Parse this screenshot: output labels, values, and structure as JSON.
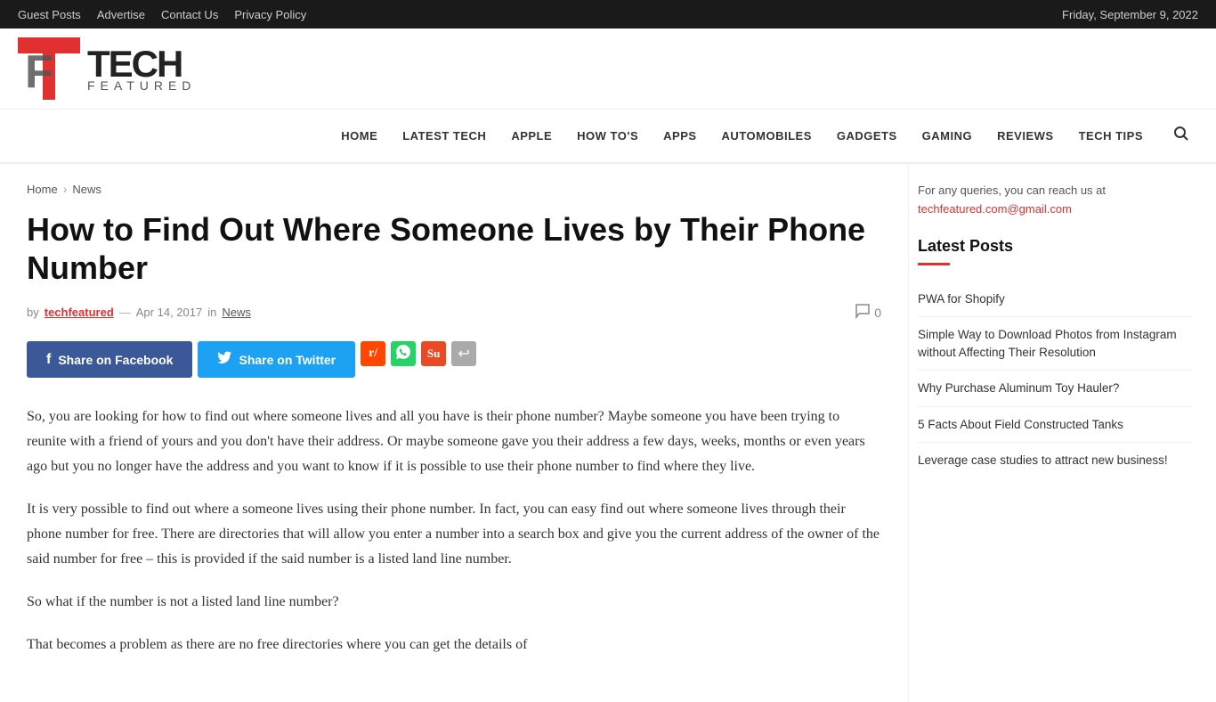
{
  "topbar": {
    "links": [
      "Guest Posts",
      "Advertise",
      "Contact Us",
      "Privacy Policy"
    ],
    "date": "Friday, September 9, 2022"
  },
  "logo": {
    "tech": "TECH",
    "featured": "FEATURED"
  },
  "nav": {
    "items": [
      "HOME",
      "LATEST TECH",
      "APPLE",
      "HOW TO'S",
      "APPS",
      "AUTOMOBILES",
      "GADGETS",
      "GAMING",
      "REVIEWS",
      "TECH TIPS"
    ]
  },
  "breadcrumb": {
    "home": "Home",
    "separator": "›",
    "current": "News"
  },
  "article": {
    "title": "How to Find Out Where Someone Lives by Their Phone Number",
    "meta": {
      "by": "by",
      "author": "techfeatured",
      "dash": "—",
      "date": "Apr 14, 2017",
      "in": "in",
      "category": "News",
      "comment_count": "0"
    },
    "share": {
      "facebook_label": "Share on Facebook",
      "twitter_label": "Share on Twitter"
    },
    "content": [
      "So, you are looking for how to find out where someone lives and all you have is their phone number? Maybe someone you have been trying to reunite with a friend of yours and you don't have their address. Or maybe someone gave you their address a few days, weeks, months or even years ago but you no longer have the address and you want to know if it is possible to use their phone number to find where they live.",
      "It is very possible to find out where a someone lives using their phone number. In fact, you can easy find out where someone lives through their phone number for free. There are directories that will allow you enter a number into a search box and give you the current address of the owner of the said number for free – this is provided if the said number is a listed land line number.",
      "So what if the number is not a listed land line number?",
      "That becomes a problem as there are no free directories where you can get the details of"
    ]
  },
  "sidebar": {
    "contact_text": "For any queries, you can reach us at",
    "contact_email": "techfeatured.com@gmail.com",
    "latest_posts_title": "Latest Posts",
    "posts": [
      "PWA for Shopify",
      "Simple Way to Download Photos from Instagram without Affecting Their Resolution",
      "Why Purchase Aluminum Toy Hauler?",
      "5 Facts About Field Constructed Tanks",
      "Leverage case studies to attract new business!"
    ]
  },
  "icons": {
    "facebook": "f",
    "twitter": "t",
    "reddit": "r",
    "whatsapp": "w",
    "stumble": "s",
    "share": "⤴",
    "comment": "💬",
    "search": "🔍",
    "chevron_right": "›"
  }
}
